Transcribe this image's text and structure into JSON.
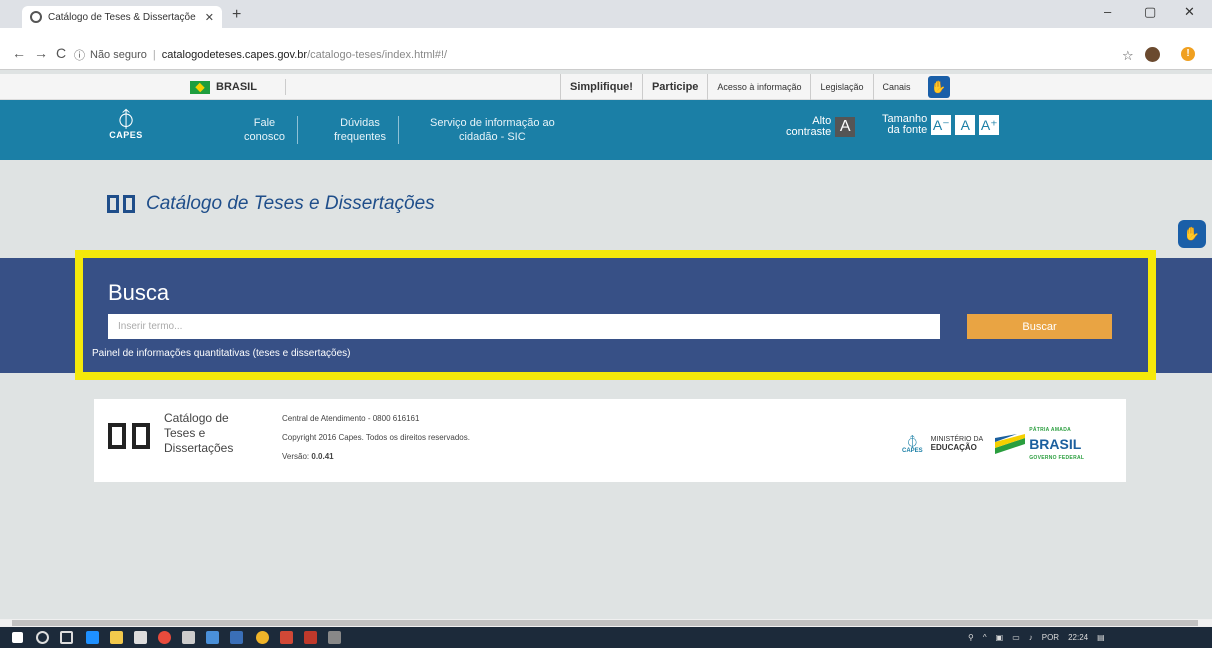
{
  "browser": {
    "tab_title": "Catálogo de Teses & Dissertaçõe",
    "tab_close": "✕",
    "new_tab": "+",
    "window_controls": [
      "–",
      "▢",
      "✕"
    ],
    "nav": {
      "back": "←",
      "forward": "→",
      "reload": "C"
    },
    "security_label": "Não seguro",
    "url_host": "catalogodeteses.capes.gov.br",
    "url_path": "/catalogo-teses/index.html#!/",
    "ext_badge": "!"
  },
  "govbar": {
    "brasil_label": "BRASIL",
    "links": [
      "Simplifique!",
      "Participe",
      "Acesso à informação",
      "Legislação",
      "Canais"
    ]
  },
  "header": {
    "logo_text": "CAPES",
    "menu": [
      {
        "line1": "Fale",
        "line2": "conosco"
      },
      {
        "line1": "Dúvidas",
        "line2": "frequentes"
      },
      {
        "line1": "Serviço de informação ao",
        "line2": "cidadão - SIC"
      }
    ],
    "contrast_line1": "Alto",
    "contrast_line2": "contraste",
    "contrast_box": "A",
    "fontsize_line1": "Tamanho",
    "fontsize_line2": "da fonte",
    "font_decrease": "A⁻",
    "font_normal": "A",
    "font_increase": "A⁺"
  },
  "page": {
    "title": "Catálogo de Teses e Dissertações"
  },
  "search": {
    "heading": "Busca",
    "placeholder": "Inserir termo...",
    "button": "Buscar",
    "panel_link": "Painel de informações quantitativas (teses e dissertações)"
  },
  "footer": {
    "brand_lines": [
      "Catálogo de",
      "Teses e",
      "Dissertações"
    ],
    "contact": "Central de Atendimento - 0800 616161",
    "copyright": "Copyright 2016 Capes. Todos os direitos reservados.",
    "version_label": "Versão:",
    "version": "0.0.41",
    "capes_logo": "CAPES",
    "mec_line1": "MINISTÉRIO DA",
    "mec_line2": "EDUCAÇÃO",
    "brasil_logo_top": "PÁTRIA AMADA",
    "brasil_logo_main": "BRASIL",
    "brasil_logo_sub": "GOVERNO FEDERAL"
  },
  "taskbar": {
    "tray_lang": "POR",
    "tray_time": "22:24"
  },
  "colors": {
    "header_blue": "#1b7fa6",
    "search_band": "#375086",
    "highlight": "#f5e90a",
    "button_orange": "#e9a443"
  }
}
